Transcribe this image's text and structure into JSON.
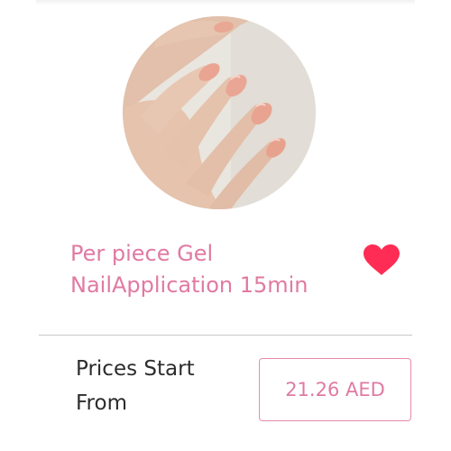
{
  "service": {
    "title": "Per piece Gel NailApplication 15min",
    "image_alt": "Pink gel nails on hand",
    "favorite_icon": "heart-icon",
    "favorite_color": "#ff2d55",
    "accent_color": "#e07aa2"
  },
  "pricing": {
    "label": "Prices Start From",
    "price": "21.26 AED"
  }
}
